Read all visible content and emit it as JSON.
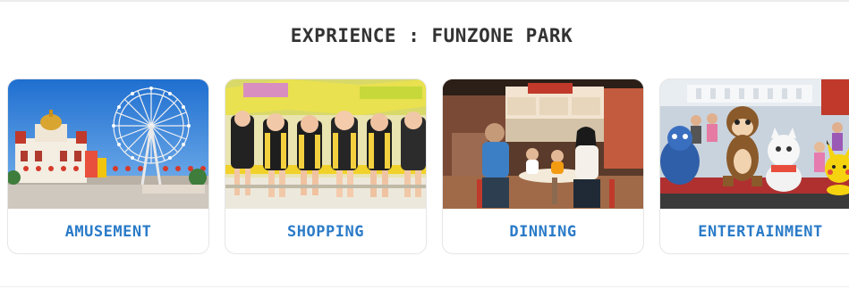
{
  "section": {
    "title": "EXPRIENCE : FUNZONE PARK"
  },
  "colors": {
    "label_blue": "#2a7bc8",
    "title_gray": "#333333",
    "border": "#e6e6e6"
  },
  "cards": [
    {
      "label": "AMUSEMENT",
      "image": "ferris-wheel-amusement-park-photo"
    },
    {
      "label": "SHOPPING",
      "image": "ride-passengers-photo"
    },
    {
      "label": "DINNING",
      "image": "family-dining-photo"
    },
    {
      "label": "ENTERTAINMENT",
      "image": "mascot-show-photo"
    }
  ]
}
